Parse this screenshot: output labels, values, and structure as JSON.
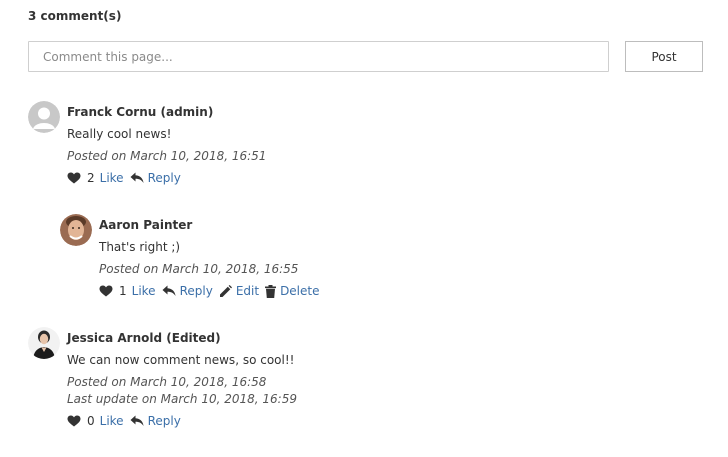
{
  "comments_count_label": "3 comment(s)",
  "composer": {
    "placeholder": "Comment this page...",
    "value": "",
    "post_label": "Post"
  },
  "comments": [
    {
      "author": "Franck Cornu (admin)",
      "avatar": "default-user-avatar-icon",
      "text": "Really cool news!",
      "posted": "Posted on March 10, 2018, 16:51",
      "likes": "2",
      "like_label": "Like",
      "reply_label": "Reply"
    },
    {
      "author": "Aaron Painter",
      "avatar": "user-photo",
      "text": "That's right ;)",
      "posted": "Posted on March 10, 2018, 16:55",
      "likes": "1",
      "like_label": "Like",
      "reply_label": "Reply",
      "edit_label": "Edit",
      "delete_label": "Delete"
    },
    {
      "author": "Jessica Arnold (Edited)",
      "avatar": "user-photo",
      "text": "We can now comment news, so cool!!",
      "posted": "Posted on March 10, 2018, 16:58",
      "updated": "Last update on March 10, 2018, 16:59",
      "likes": "0",
      "like_label": "Like",
      "reply_label": "Reply"
    }
  ],
  "colors": {
    "link": "#3b6fa8",
    "text": "#333333",
    "border": "#cfcfcf"
  }
}
